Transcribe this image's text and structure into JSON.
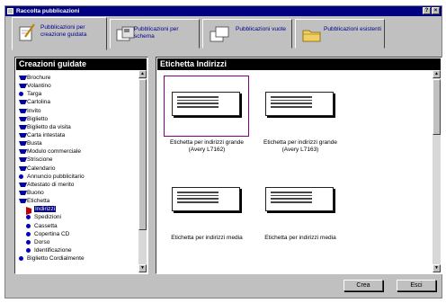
{
  "window": {
    "title": "Raccolta pubblicazioni",
    "help_label": "?",
    "close_label": "×"
  },
  "tabs": [
    {
      "label": "Pubblicazioni per creazione guidata",
      "icon": "wizard-pencil-icon",
      "active": true
    },
    {
      "label": "Pubblicazioni per schema",
      "icon": "blueprint-icon",
      "active": false
    },
    {
      "label": "Pubblicazioni vuote",
      "icon": "blank-page-icon",
      "active": false
    },
    {
      "label": "Pubblicazioni esistenti",
      "icon": "folder-icon",
      "active": false
    }
  ],
  "left_pane": {
    "title": "Creazioni guidate",
    "items": [
      {
        "label": "Brochure",
        "bullet": "triangle"
      },
      {
        "label": "Volantino",
        "bullet": "triangle"
      },
      {
        "label": "Targa",
        "bullet": "dot"
      },
      {
        "label": "Cartolina",
        "bullet": "triangle"
      },
      {
        "label": "Invito",
        "bullet": "triangle"
      },
      {
        "label": "Biglietto",
        "bullet": "triangle"
      },
      {
        "label": "Biglietto da visita",
        "bullet": "triangle"
      },
      {
        "label": "Carta intestata",
        "bullet": "triangle"
      },
      {
        "label": "Busta",
        "bullet": "triangle"
      },
      {
        "label": "Modulo commerciale",
        "bullet": "triangle"
      },
      {
        "label": "Striscione",
        "bullet": "triangle"
      },
      {
        "label": "Calendario",
        "bullet": "triangle"
      },
      {
        "label": "Annuncio pubblicitario",
        "bullet": "dot"
      },
      {
        "label": "Attestato di merito",
        "bullet": "triangle"
      },
      {
        "label": "Buono",
        "bullet": "triangle"
      },
      {
        "label": "Etichetta",
        "bullet": "triangle"
      },
      {
        "label": "Indirizzi",
        "bullet": "arrow",
        "sub": true,
        "selected": true
      },
      {
        "label": "Spedizioni",
        "bullet": "dot",
        "sub": true
      },
      {
        "label": "Cassetta",
        "bullet": "dot",
        "sub": true
      },
      {
        "label": "Copertina CD",
        "bullet": "dot",
        "sub": true
      },
      {
        "label": "Dorso",
        "bullet": "dot",
        "sub": true
      },
      {
        "label": "Identificazione",
        "bullet": "dot",
        "sub": true
      },
      {
        "label": "Biglietto Cordialmente",
        "bullet": "dot"
      }
    ]
  },
  "right_pane": {
    "title": "Etichetta Indirizzi",
    "cards": [
      {
        "caption1": "Etichetta per indirizzi grande",
        "caption2": "(Avery L7162)",
        "selected": true
      },
      {
        "caption1": "Etichetta per indirizzi grande",
        "caption2": "(Avery L7163)",
        "selected": false
      },
      {
        "caption1": "Etichetta per indirizzi media",
        "caption2": "",
        "selected": false
      },
      {
        "caption1": "Etichetta per indirizzi media",
        "caption2": "",
        "selected": false
      }
    ]
  },
  "footer": {
    "create_label": "Crea",
    "exit_label": "Esci"
  },
  "colors": {
    "titlebar": "#000080",
    "pane_header": "#000000",
    "face": "#c0c0c0",
    "selection": "#800080",
    "bullet": "#0000c0"
  }
}
